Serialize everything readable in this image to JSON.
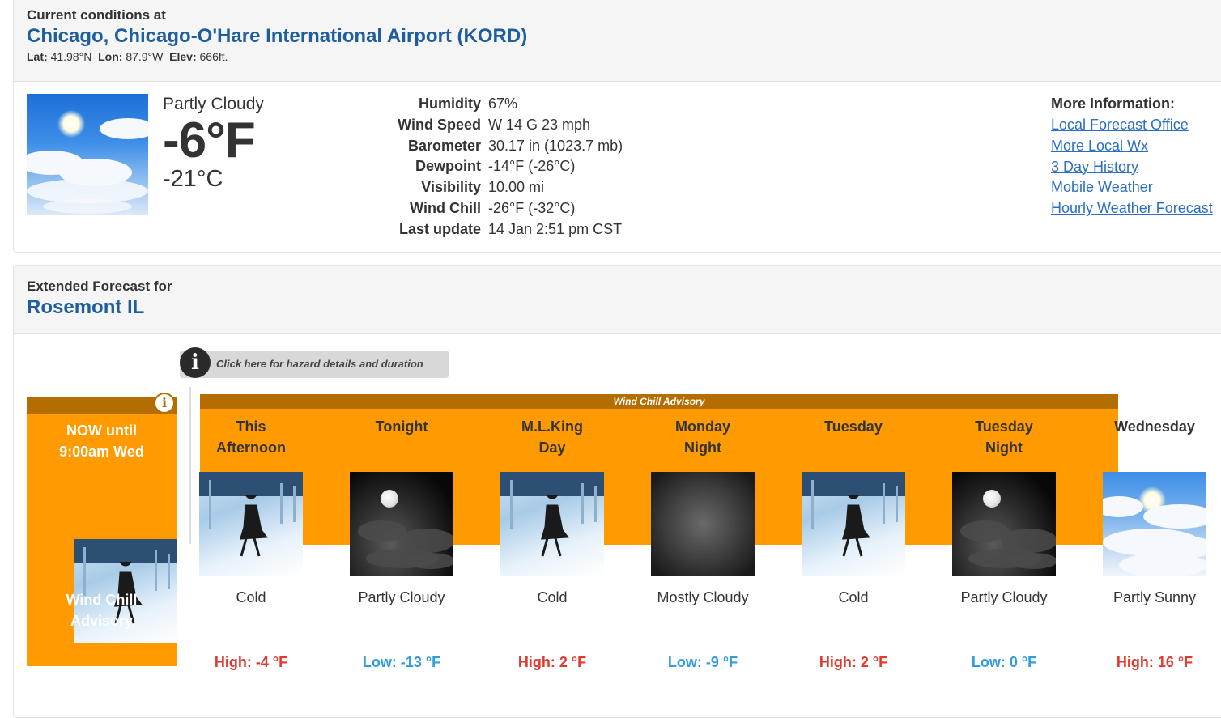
{
  "current": {
    "heading": "Current conditions at",
    "station": "Chicago, Chicago-O'Hare International Airport (KORD)",
    "lat_label": "Lat:",
    "lat": "41.98°N",
    "lon_label": "Lon:",
    "lon": "87.9°W",
    "elev_label": "Elev:",
    "elev": "666ft.",
    "condition": "Partly Cloudy",
    "temp_f": "-6°F",
    "temp_c": "-21°C",
    "details": [
      {
        "label": "Humidity",
        "value": "67%"
      },
      {
        "label": "Wind Speed",
        "value": "W 14 G 23 mph"
      },
      {
        "label": "Barometer",
        "value": "30.17 in (1023.7 mb)"
      },
      {
        "label": "Dewpoint",
        "value": "-14°F (-26°C)"
      },
      {
        "label": "Visibility",
        "value": "10.00 mi"
      },
      {
        "label": "Wind Chill",
        "value": "-26°F (-32°C)"
      },
      {
        "label": "Last update",
        "value": "14 Jan 2:51 pm CST"
      }
    ],
    "more_info": {
      "title": "More Information:",
      "links": [
        "Local Forecast Office",
        "More Local Wx",
        "3 Day History",
        "Mobile Weather",
        "Hourly Weather Forecast"
      ]
    }
  },
  "extended": {
    "heading": "Extended Forecast for",
    "location": "Rosemont IL",
    "hazard_button": "Click here for hazard details and duration",
    "advisory_bar": "Wind Chill Advisory",
    "now": {
      "title_line1": "NOW until",
      "title_line2": "9:00am Wed",
      "label_line1": "Wind Chill",
      "label_line2": "Advisory",
      "icon": "cold-icon"
    },
    "periods": [
      {
        "name1": "This",
        "name2": "Afternoon",
        "short": "Cold",
        "temp": "High: -4 °F",
        "kind": "hi",
        "icon": "cold-icon"
      },
      {
        "name1": "Tonight",
        "name2": "",
        "short": "Partly Cloudy",
        "temp": "Low: -13 °F",
        "kind": "lo",
        "icon": "partly-cloudy-night-icon"
      },
      {
        "name1": "M.L.King",
        "name2": "Day",
        "short": "Cold",
        "temp": "High: 2 °F",
        "kind": "hi",
        "icon": "cold-icon"
      },
      {
        "name1": "Monday",
        "name2": "Night",
        "short": "Mostly Cloudy",
        "temp": "Low: -9 °F",
        "kind": "lo",
        "icon": "mostly-cloudy-night-icon"
      },
      {
        "name1": "Tuesday",
        "name2": "",
        "short": "Cold",
        "temp": "High: 2 °F",
        "kind": "hi",
        "icon": "cold-icon"
      },
      {
        "name1": "Tuesday",
        "name2": "Night",
        "short": "Partly Cloudy",
        "temp": "Low: 0 °F",
        "kind": "lo",
        "icon": "partly-cloudy-night-icon"
      },
      {
        "name1": "Wednesday",
        "name2": "",
        "short": "Partly Sunny",
        "temp": "High: 16 °F",
        "kind": "hi",
        "icon": "partly-sunny-icon"
      }
    ],
    "colors": {
      "advisory": "#ff9b00",
      "advisory_bar": "#b36d00",
      "high": "#e03a2f",
      "low": "#2f9be0"
    }
  }
}
